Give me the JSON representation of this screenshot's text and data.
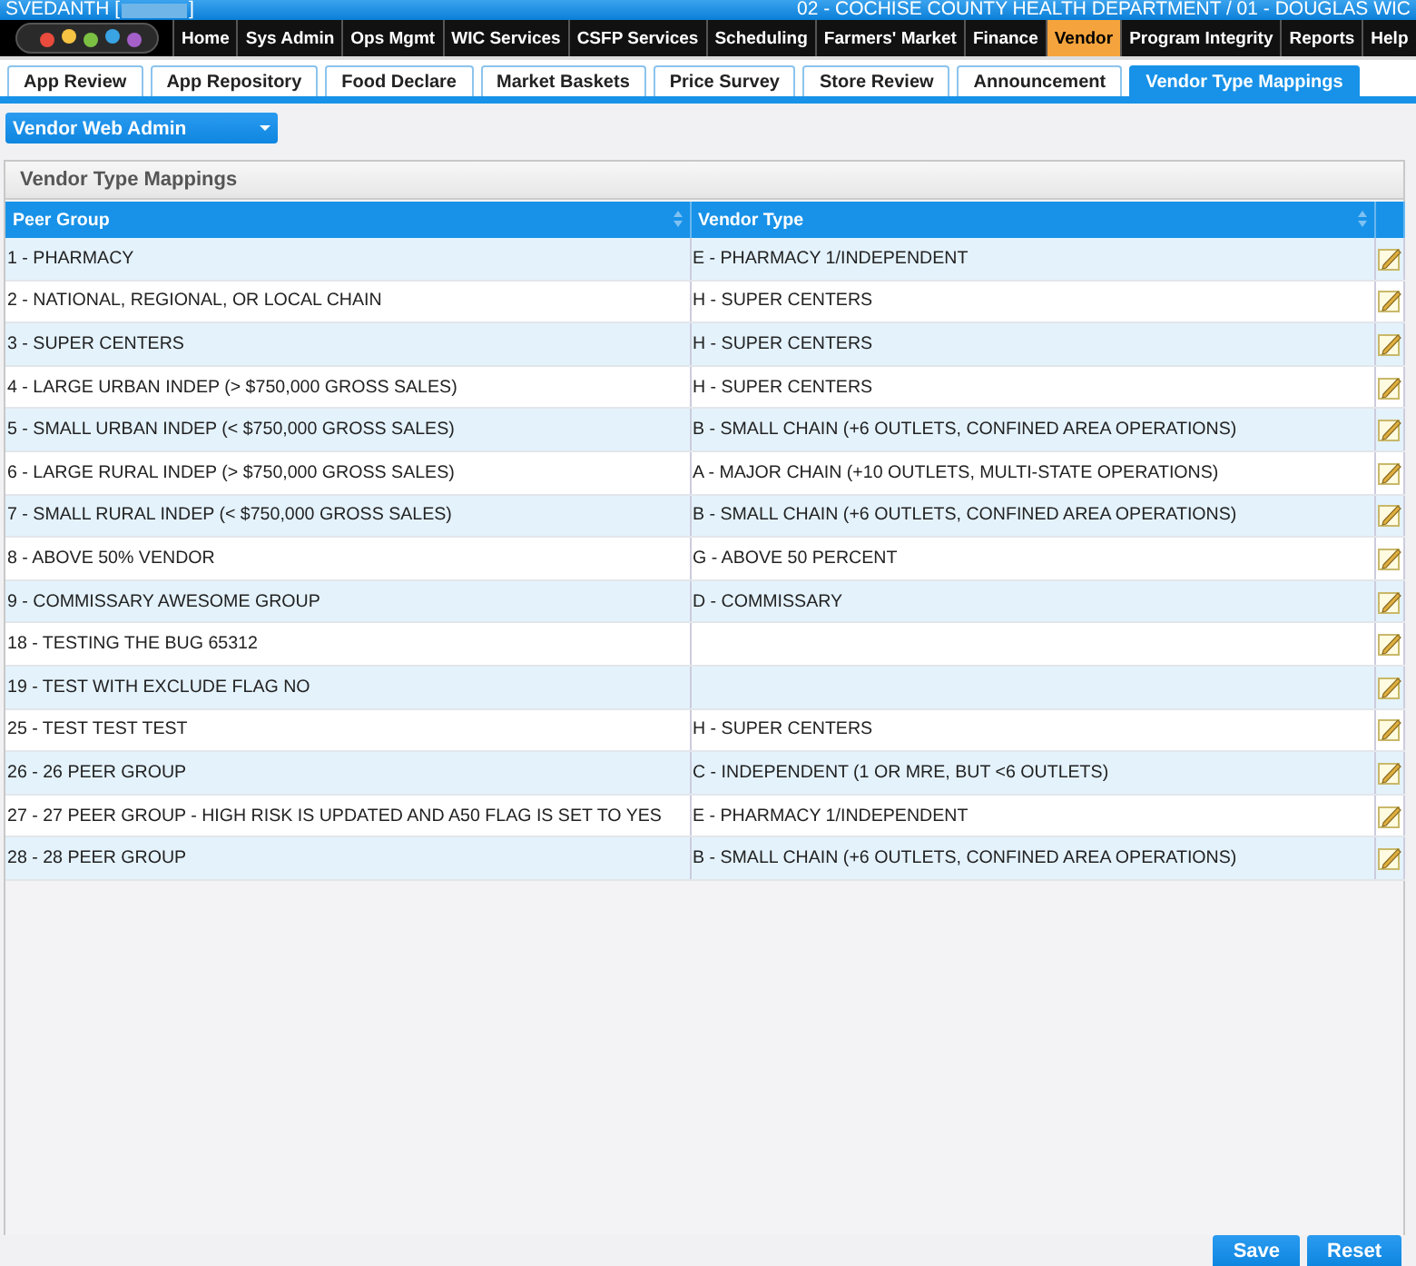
{
  "header": {
    "user": "SVEDANTH [",
    "user_end": "]",
    "location": "02 - COCHISE COUNTY HEALTH DEPARTMENT / 01 - DOUGLAS WIC"
  },
  "nav": [
    {
      "label": "Home",
      "selected": false
    },
    {
      "label": "Sys Admin",
      "selected": false
    },
    {
      "label": "Ops Mgmt",
      "selected": false
    },
    {
      "label": "WIC Services",
      "selected": false
    },
    {
      "label": "CSFP Services",
      "selected": false
    },
    {
      "label": "Scheduling",
      "selected": false
    },
    {
      "label": "Farmers' Market",
      "selected": false
    },
    {
      "label": "Finance",
      "selected": false
    },
    {
      "label": "Vendor",
      "selected": true
    },
    {
      "label": "Program Integrity",
      "selected": false
    },
    {
      "label": "Reports",
      "selected": false
    },
    {
      "label": "Help",
      "selected": false
    }
  ],
  "tabs": [
    {
      "label": "App Review",
      "selected": false
    },
    {
      "label": "App Repository",
      "selected": false
    },
    {
      "label": "Food Declare",
      "selected": false
    },
    {
      "label": "Market Baskets",
      "selected": false
    },
    {
      "label": "Price Survey",
      "selected": false
    },
    {
      "label": "Store Review",
      "selected": false
    },
    {
      "label": "Announcement",
      "selected": false
    },
    {
      "label": "Vendor Type Mappings",
      "selected": true
    }
  ],
  "dropdown": {
    "value": "Vendor Web Admin"
  },
  "panel": {
    "title": "Vendor Type Mappings"
  },
  "table": {
    "columns": [
      "Peer Group",
      "Vendor Type"
    ],
    "rows": [
      {
        "peer_group": "1 - PHARMACY",
        "vendor_type": "E - PHARMACY 1/INDEPENDENT"
      },
      {
        "peer_group": "2 - NATIONAL, REGIONAL, OR LOCAL CHAIN",
        "vendor_type": "H - SUPER CENTERS"
      },
      {
        "peer_group": "3 - SUPER CENTERS",
        "vendor_type": "H - SUPER CENTERS"
      },
      {
        "peer_group": "4 - LARGE URBAN INDEP (> $750,000 GROSS SALES)",
        "vendor_type": "H - SUPER CENTERS"
      },
      {
        "peer_group": "5 - SMALL URBAN INDEP (< $750,000 GROSS SALES)",
        "vendor_type": "B - SMALL CHAIN (+6 OUTLETS, CONFINED AREA OPERATIONS)"
      },
      {
        "peer_group": "6 - LARGE RURAL INDEP (> $750,000 GROSS SALES)",
        "vendor_type": "A - MAJOR CHAIN (+10 OUTLETS, MULTI-STATE OPERATIONS)"
      },
      {
        "peer_group": "7 - SMALL RURAL INDEP (< $750,000 GROSS SALES)",
        "vendor_type": "B - SMALL CHAIN (+6 OUTLETS, CONFINED AREA OPERATIONS)"
      },
      {
        "peer_group": "8 - ABOVE 50% VENDOR",
        "vendor_type": "G - ABOVE 50 PERCENT"
      },
      {
        "peer_group": "9 - COMMISSARY AWESOME GROUP",
        "vendor_type": "D - COMMISSARY"
      },
      {
        "peer_group": "18 - TESTING THE BUG 65312"
      },
      {
        "peer_group": "19 - TEST WITH EXCLUDE FLAG NO"
      },
      {
        "peer_group": "25 - TEST TEST TEST",
        "vendor_type": "H - SUPER CENTERS"
      },
      {
        "peer_group": "26 - 26 PEER GROUP",
        "vendor_type": "C - INDEPENDENT (1 OR MRE, BUT <6 OUTLETS)"
      },
      {
        "peer_group": "27 - 27 PEER GROUP - HIGH RISK IS UPDATED AND A50 FLAG IS SET TO YES",
        "vendor_type": "E - PHARMACY 1/INDEPENDENT"
      },
      {
        "peer_group": "28 - 28 PEER GROUP",
        "vendor_type": "B - SMALL CHAIN (+6 OUTLETS, CONFINED AREA OPERATIONS)"
      }
    ]
  },
  "buttons": [
    "Save",
    "Reset"
  ]
}
